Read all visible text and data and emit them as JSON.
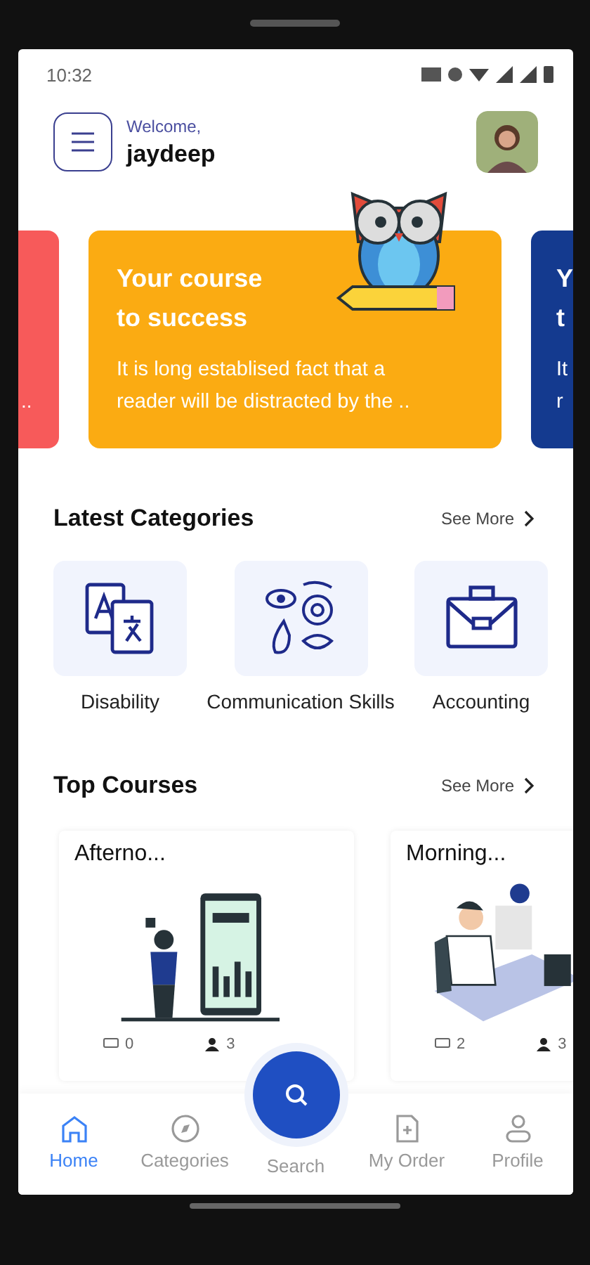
{
  "status_bar": {
    "time": "10:32"
  },
  "header": {
    "greeting": "Welcome,",
    "name": "jaydeep"
  },
  "banners": [
    {
      "kind": "left",
      "color": "#f75a5a",
      "text": [
        ".."
      ]
    },
    {
      "kind": "main",
      "color": "#fbab12",
      "title": [
        "Your course",
        "to success"
      ],
      "text": [
        "It is long establised fact that a",
        "reader will be distracted by the .."
      ]
    },
    {
      "kind": "right",
      "color": "#143a8f",
      "title": [
        "Y",
        "t"
      ],
      "text": [
        "It",
        "r"
      ]
    }
  ],
  "categories": {
    "title": "Latest Categories",
    "see_more": "See More",
    "items": [
      {
        "kind": "translate",
        "label": "Disability"
      },
      {
        "kind": "faces",
        "label": "Communication Skills"
      },
      {
        "kind": "briefcase",
        "label": "Accounting"
      }
    ]
  },
  "courses": {
    "title": "Top Courses",
    "see_more": "See More",
    "items": [
      {
        "kind": "finance",
        "title": "Afterno...",
        "comments": "0",
        "students": "3"
      },
      {
        "kind": "office",
        "title": "Morning...",
        "comments": "2",
        "students": "3"
      }
    ]
  },
  "nav": [
    {
      "kind": "home",
      "label": "Home",
      "selected": true
    },
    {
      "kind": "categories",
      "label": "Categories",
      "selected": false
    },
    {
      "kind": "search",
      "label": "Search",
      "selected": false
    },
    {
      "kind": "order",
      "label": "My Order",
      "selected": false
    },
    {
      "kind": "profile",
      "label": "Profile",
      "selected": false
    }
  ]
}
